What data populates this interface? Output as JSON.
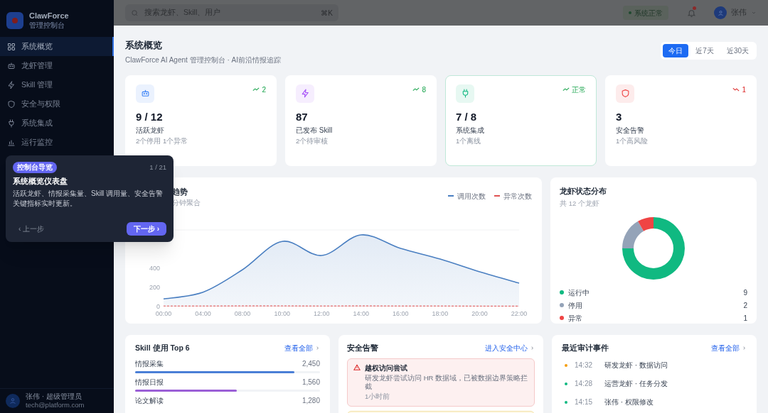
{
  "sidebar": {
    "brand": {
      "name": "ClawForce",
      "subtitle": "管理控制台"
    },
    "items": [
      {
        "kind": "grid",
        "label": "系统概览",
        "selected": true
      },
      {
        "kind": "robot",
        "label": "龙虾管理",
        "selected": false
      },
      {
        "kind": "bolt",
        "label": "Skill 管理",
        "selected": false
      },
      {
        "kind": "shield",
        "label": "安全与权限",
        "selected": false
      },
      {
        "kind": "plug",
        "label": "系统集成",
        "selected": false
      },
      {
        "kind": "bars",
        "label": "运行监控",
        "selected": false
      }
    ],
    "user": {
      "name": "张伟 · 超级管理员",
      "email": "tech@platform.com"
    }
  },
  "topbar": {
    "search": {
      "placeholder": "搜索龙虾、Skill、用户",
      "shortcut": "⌘K"
    },
    "status": {
      "label": "系统正常"
    },
    "notifications": {
      "unread": true
    },
    "user": {
      "name": "张伟"
    }
  },
  "header": {
    "title": "系统概览",
    "subtitle": "ClawForce AI Agent 管理控制台 · AI前沿情报追踪",
    "ranges": [
      {
        "label": "今日",
        "selected": true
      },
      {
        "label": "近7天",
        "selected": false
      },
      {
        "label": "近30天",
        "selected": false
      }
    ]
  },
  "stats": [
    {
      "kind": "robot",
      "color": "#3b82f6",
      "value": "9 / 12",
      "label": "活跃龙虾",
      "note": "2个停用 1个异常",
      "trend": "2",
      "trend_down": false,
      "highlighted": false
    },
    {
      "kind": "bolt",
      "color": "#a855f7",
      "value": "87",
      "label": "已发布 Skill",
      "note": "2个待审核",
      "trend": "8",
      "trend_down": false,
      "highlighted": false
    },
    {
      "kind": "plug",
      "color": "#10b981",
      "value": "7 / 8",
      "label": "系统集成",
      "note": "1个离线",
      "trend": "正常",
      "trend_down": false,
      "highlighted": true
    },
    {
      "kind": "shield",
      "color": "#ef4444",
      "value": "3",
      "label": "安全告警",
      "note": "1个高风险",
      "trend": "1",
      "trend_down": true,
      "highlighted": false
    }
  ],
  "tour": {
    "badge": "控制台导览",
    "step": "1 / 21",
    "title": "系统概览仪表盘",
    "body": [
      "活跃龙虾、情报采集量、Skill 调用量、安全告警",
      "关键指标实时更新。"
    ],
    "prev": "‹ 上一步",
    "next": "下一步 ›"
  },
  "trend_card": {
    "title": "趋势",
    "subtitle": "分钟聚合",
    "chart_data": {
      "type": "area",
      "categories": [
        "00:00",
        "04:00",
        "08:00",
        "10:00",
        "12:00",
        "14:00",
        "16:00",
        "18:00",
        "20:00",
        "22:00"
      ],
      "series": [
        {
          "name": "调用次数",
          "color": "#4a7fc1",
          "line_style": "solid",
          "values": [
            80,
            150,
            385,
            680,
            533,
            748,
            607,
            496,
            363,
            245
          ]
        },
        {
          "name": "异常次数",
          "color": "#e05252",
          "line_style": "dashed",
          "values": [
            6,
            6,
            7,
            7,
            6,
            7,
            6,
            6,
            5,
            5
          ]
        }
      ],
      "ylim": [
        0,
        800
      ],
      "yticks": [
        0,
        200,
        400
      ]
    }
  },
  "status_card": {
    "title": "龙虾状态分布",
    "subtitle": "共 12 个龙虾",
    "chart_data": {
      "type": "donut",
      "categories": [
        "运行中",
        "停用",
        "异常"
      ],
      "values": [
        75,
        16.7,
        8.3
      ]
    },
    "items": [
      {
        "count": "9",
        "color": "#10b981"
      },
      {
        "count": "2",
        "color": "#94a3b8"
      },
      {
        "count": "1",
        "color": "#ef4444"
      }
    ]
  },
  "skills": {
    "title": "Skill 使用 Top 6",
    "link": "查看全部",
    "items": [
      {
        "label": "情报采集",
        "value": "2,450",
        "level": 0.86,
        "color": "#4a7fd6"
      },
      {
        "label": "情报日报",
        "value": "1,560",
        "level": 0.55,
        "color": "#9b5fd6"
      },
      {
        "label": "论文解读",
        "value": "1,280"
      }
    ]
  },
  "alerts": {
    "title": "安全告警",
    "link": "进入安全中心",
    "items": [
      {
        "kind": "danger",
        "title": "越权访问尝试",
        "body": "研发龙虾尝试访问 HR 数据域，已被数据边界策略拦截",
        "time": "1小时前"
      },
      {
        "kind": "warning"
      }
    ]
  },
  "audit": {
    "title": "最近审计事件",
    "link": "查看全部",
    "items": [
      {
        "time": "14:32",
        "text": "研发龙虾 · 数据访问",
        "color": "#f59e0b"
      },
      {
        "time": "14:28",
        "text": "运营龙虾 · 任务分发",
        "color": "#10b981"
      },
      {
        "time": "14:15",
        "text": "张伟 · 权限修改",
        "color": "#10b981"
      }
    ]
  }
}
